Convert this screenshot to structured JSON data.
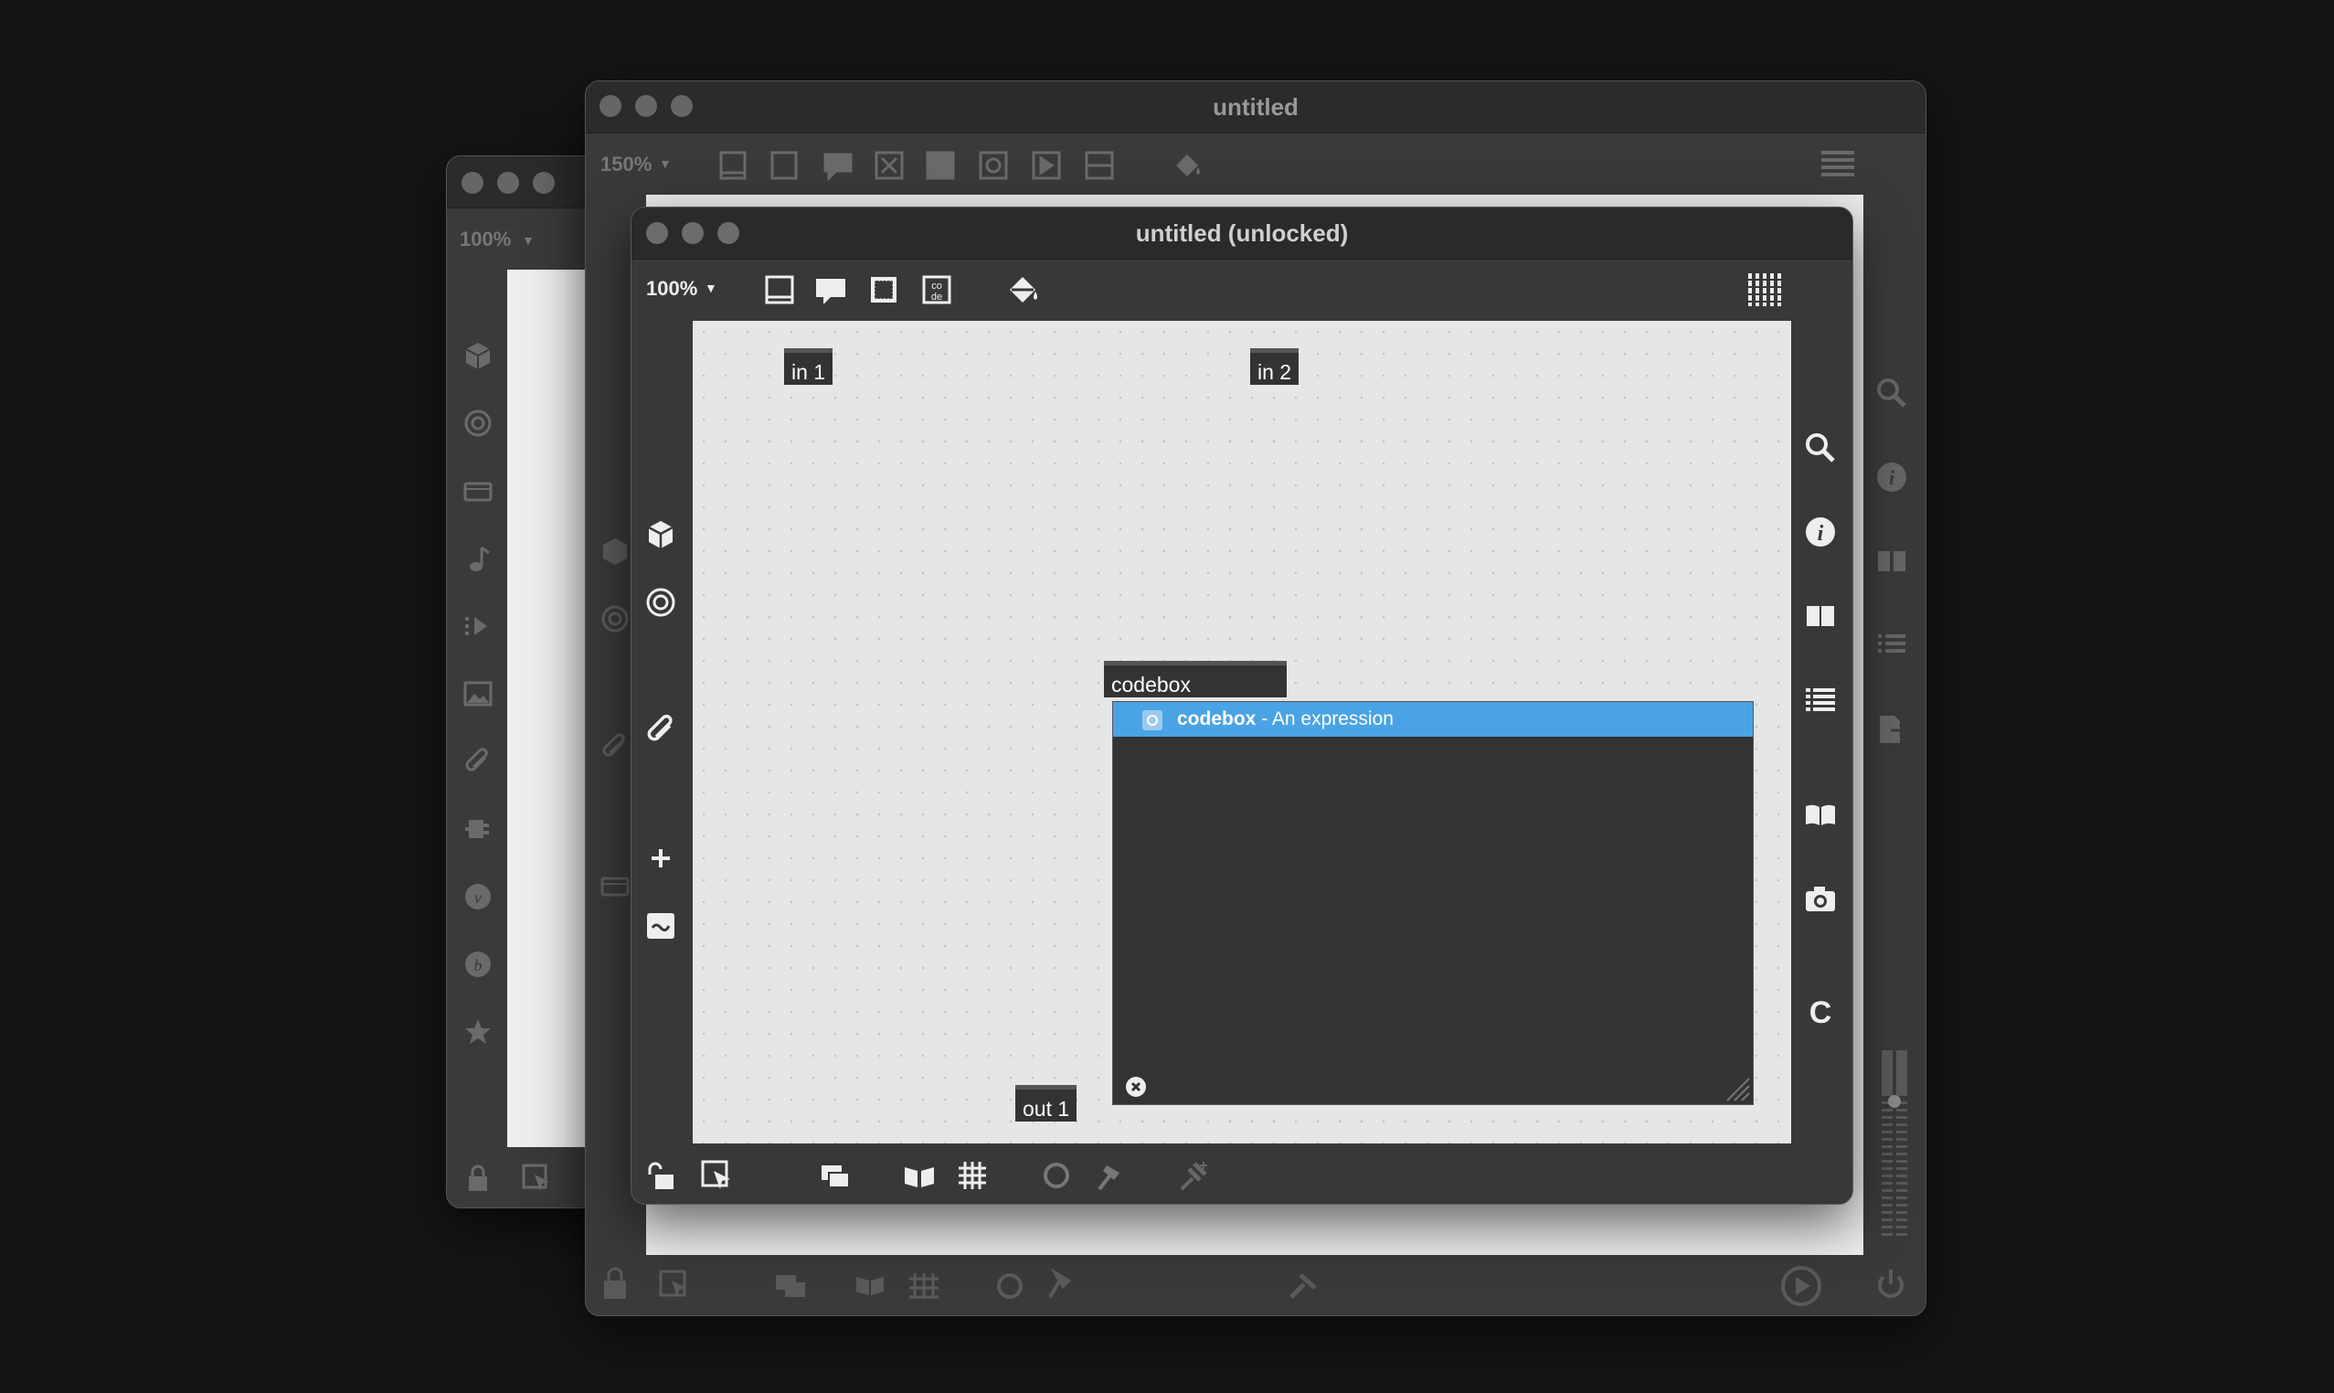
{
  "windows": {
    "back": {
      "zoom": "100%"
    },
    "middle": {
      "title": "untitled",
      "zoom": "150%"
    },
    "front": {
      "title": "untitled (unlocked)",
      "zoom": "100%",
      "objects": {
        "in1": "in 1",
        "in2": "in 2",
        "codebox": "codebox",
        "out1": "out 1"
      },
      "autocomplete": {
        "item_name": "codebox",
        "item_description": " - An expression"
      }
    }
  },
  "icons": {
    "left_toolbar": [
      "package-icon",
      "target-icon",
      "paperclip-icon",
      "plus-icon",
      "tilde-icon"
    ],
    "right_toolbar": [
      "search-icon",
      "info-icon",
      "columns-icon",
      "list-icon",
      "book-icon",
      "camera-icon",
      "c-icon"
    ],
    "bottom_toolbar": [
      "lock-icon",
      "select-icon",
      "layers-icon",
      "flip-icon",
      "grid-icon",
      "refresh-icon",
      "hammer-icon",
      "pin-icon"
    ]
  },
  "colors": {
    "selection": "#4aa3e4",
    "canvas": "#e6e6e6",
    "window": "#3a3a3a"
  }
}
